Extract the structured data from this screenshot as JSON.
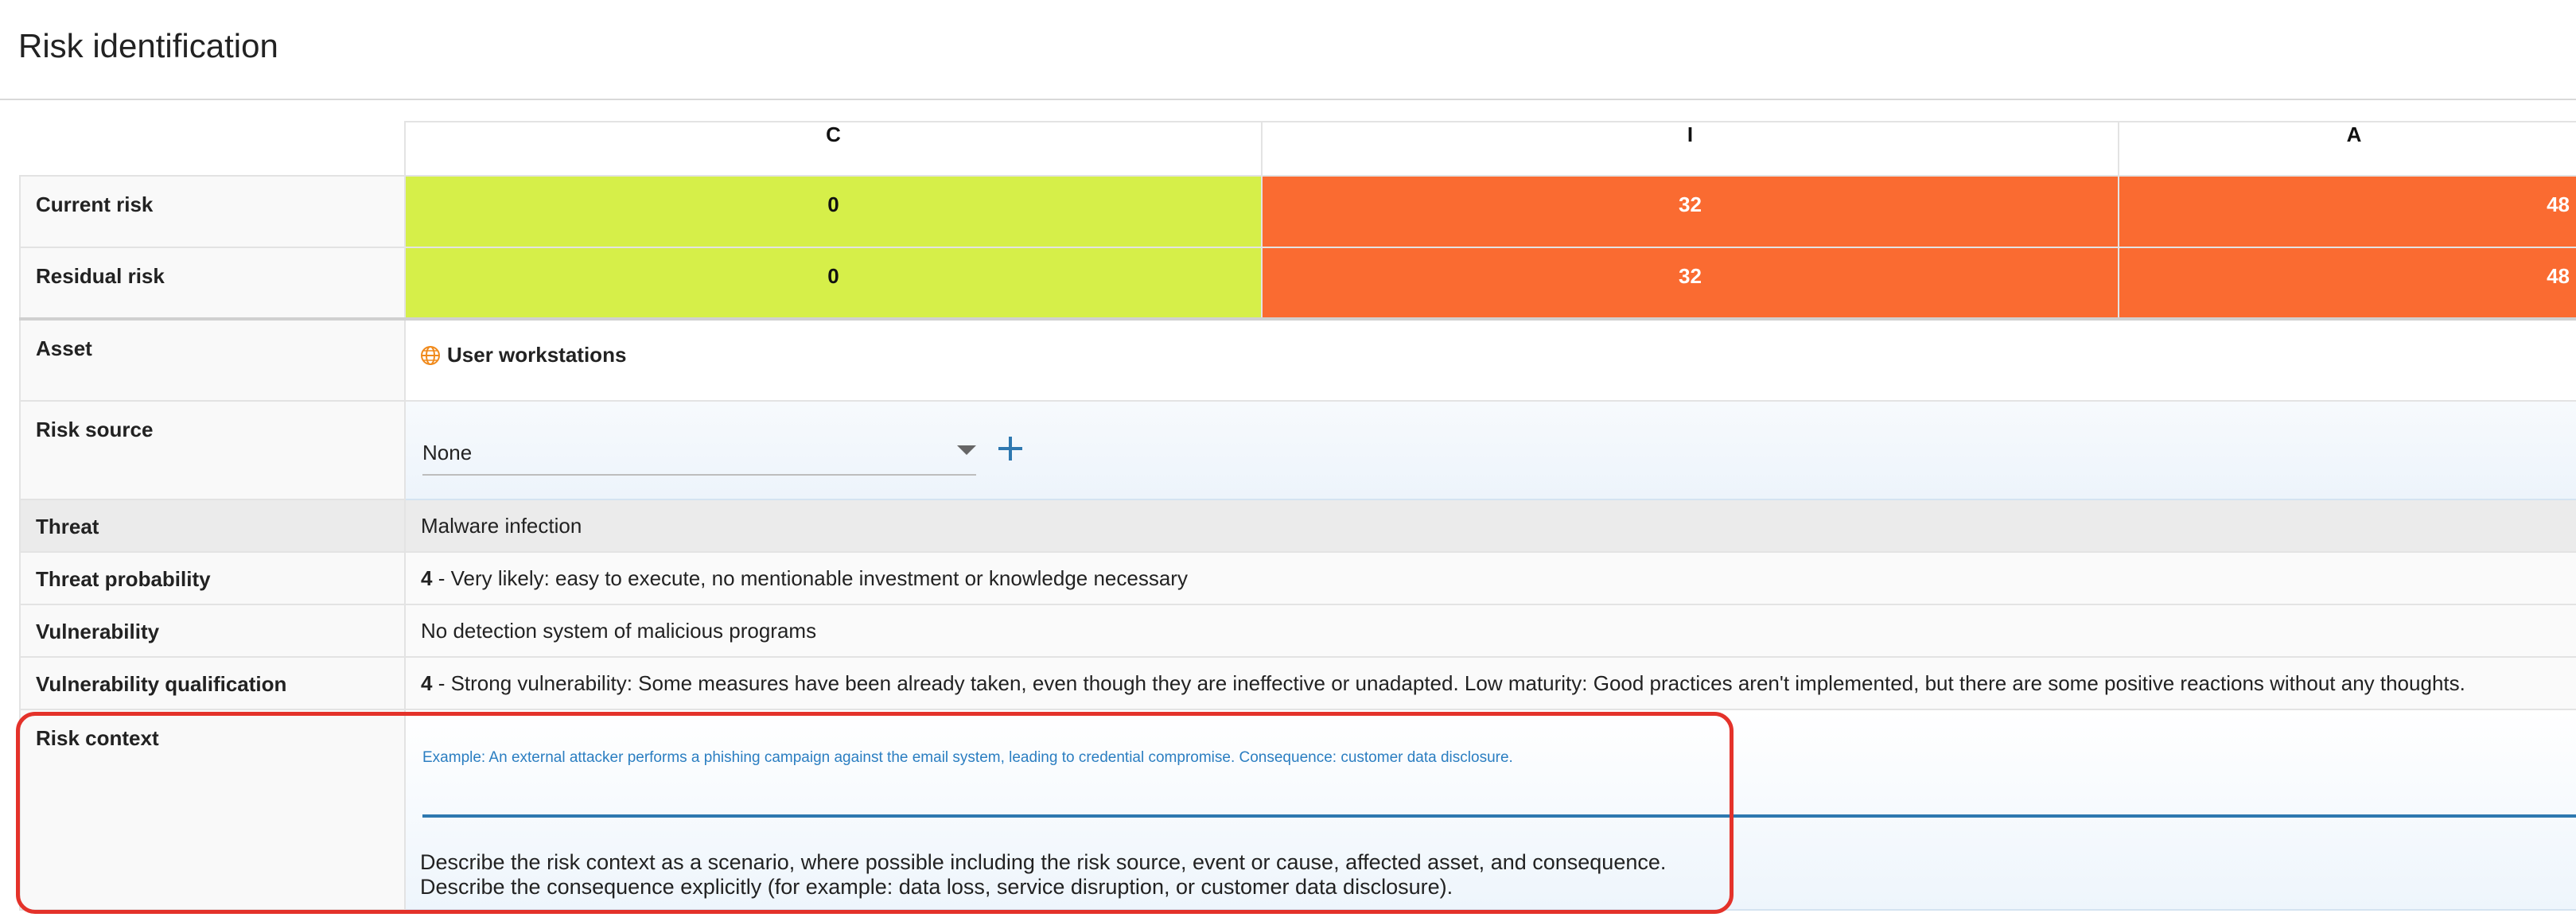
{
  "page": {
    "title": "Risk identification"
  },
  "columns": [
    "C",
    "I",
    "A"
  ],
  "current_risk": {
    "label": "Current risk",
    "values": [
      "0",
      "32",
      "48"
    ],
    "colors": [
      "#d6ef49",
      "#fa6b31",
      "#fa6b31"
    ]
  },
  "residual_risk": {
    "label": "Residual risk",
    "values": [
      "0",
      "32",
      "48"
    ],
    "colors": [
      "#d6ef49",
      "#fa6b31",
      "#fa6b31"
    ]
  },
  "asset": {
    "label": "Asset",
    "icon": "globe-icon",
    "value": "User workstations"
  },
  "risk_source": {
    "label": "Risk source",
    "selected": "None",
    "add_icon": "plus-icon"
  },
  "threat": {
    "label": "Threat",
    "value": "Malware infection"
  },
  "threat_probability": {
    "label": "Threat probability",
    "level": "4",
    "text": " - Very likely: easy to execute, no mentionable investment or knowledge necessary"
  },
  "vulnerability": {
    "label": "Vulnerability",
    "value": "No detection system of malicious programs"
  },
  "vulnerability_qualification": {
    "label": "Vulnerability qualification",
    "level": "4",
    "text": " - Strong vulnerability: Some measures have been already taken, even though they are ineffective or unadapted. Low maturity: Good practices aren't implemented, but there are some positive reactions without any thoughts."
  },
  "risk_context": {
    "label": "Risk context",
    "placeholder": "Example: An external attacker performs a phishing campaign against the email system, leading to credential compromise. Consequence: customer data disclosure.",
    "value": "",
    "help_line1": "Describe the risk context as a scenario, where possible including the risk source, event or cause, affected asset, and consequence.",
    "help_line2": "Describe the consequence explicitly (for example: data loss, service disruption, or customer data disclosure)."
  },
  "colors": {
    "accent": "#2e78b0",
    "highlight": "#e4322a",
    "low": "#d6ef49",
    "high": "#fa6b31"
  }
}
